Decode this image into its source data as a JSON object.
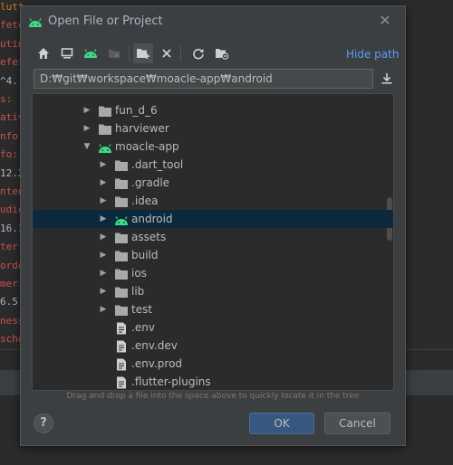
{
  "background_editor": {
    "lines": [
      {
        "text": "lutter:",
        "color": "#cc7832"
      },
      {
        "text": "fetch",
        "color": "#c75450"
      },
      {
        "text": "utin",
        "color": "#c75450"
      },
      {
        "text": "efer",
        "color": "#c75450"
      },
      {
        "text": "^4.",
        "color": "#a9b7c6"
      },
      {
        "text": "s:",
        "color": "#c75450"
      },
      {
        "text": "ativ",
        "color": "#c75450"
      },
      {
        "text": "nfo:",
        "color": "#c75450"
      },
      {
        "text": "fo:",
        "color": "#c75450"
      },
      {
        "text": "12.2",
        "color": "#a9b7c6"
      },
      {
        "text": "nten",
        "color": "#c75450"
      },
      {
        "text": "udic",
        "color": "#c75450"
      },
      {
        "text": "16.1",
        "color": "#a9b7c6"
      },
      {
        "text": "ter:",
        "color": "#c75450"
      },
      {
        "text": "order",
        "color": "#c75450"
      },
      {
        "text": "mer:",
        "color": "#c75450"
      },
      {
        "text": "6.5",
        "color": "#a9b7c6"
      },
      {
        "text": "ness",
        "color": "#c75450"
      },
      {
        "text": "sched",
        "color": "#c75450"
      }
    ]
  },
  "dialog": {
    "title": "Open File or Project",
    "close_icon": "close-icon",
    "toolbar": {
      "buttons": [
        {
          "name": "home-icon",
          "active": false
        },
        {
          "name": "desktop-icon",
          "active": false
        },
        {
          "name": "android-project-icon",
          "active": false
        },
        {
          "name": "module-icon",
          "active": false
        },
        {
          "name": "new-folder-icon",
          "active": true
        },
        {
          "name": "delete-icon",
          "active": false
        },
        {
          "name": "refresh-icon",
          "active": false
        },
        {
          "name": "show-hidden-icon",
          "active": false
        }
      ],
      "hide_path_label": "Hide path"
    },
    "path_value": "D:₩git₩workspace₩moacle-app₩android",
    "download_icon": "download-icon",
    "tree": {
      "rows": [
        {
          "label": "fun_d_6",
          "indent": 1,
          "arrow": "collapsed",
          "icon": "folder",
          "selected": false
        },
        {
          "label": "harviewer",
          "indent": 1,
          "arrow": "collapsed",
          "icon": "folder",
          "selected": false
        },
        {
          "label": "moacle-app",
          "indent": 1,
          "arrow": "expanded",
          "icon": "android",
          "selected": false
        },
        {
          "label": ".dart_tool",
          "indent": 2,
          "arrow": "collapsed",
          "icon": "folder",
          "selected": false
        },
        {
          "label": ".gradle",
          "indent": 2,
          "arrow": "collapsed",
          "icon": "folder",
          "selected": false
        },
        {
          "label": ".idea",
          "indent": 2,
          "arrow": "collapsed",
          "icon": "folder",
          "selected": false
        },
        {
          "label": "android",
          "indent": 2,
          "arrow": "collapsed",
          "icon": "android",
          "selected": true
        },
        {
          "label": "assets",
          "indent": 2,
          "arrow": "collapsed",
          "icon": "folder",
          "selected": false
        },
        {
          "label": "build",
          "indent": 2,
          "arrow": "collapsed",
          "icon": "folder",
          "selected": false
        },
        {
          "label": "ios",
          "indent": 2,
          "arrow": "collapsed",
          "icon": "folder",
          "selected": false
        },
        {
          "label": "lib",
          "indent": 2,
          "arrow": "collapsed",
          "icon": "folder",
          "selected": false
        },
        {
          "label": "test",
          "indent": 2,
          "arrow": "collapsed",
          "icon": "folder",
          "selected": false
        },
        {
          "label": ".env",
          "indent": 2,
          "arrow": "none",
          "icon": "file",
          "selected": false
        },
        {
          "label": ".env.dev",
          "indent": 2,
          "arrow": "none",
          "icon": "file",
          "selected": false
        },
        {
          "label": ".env.prod",
          "indent": 2,
          "arrow": "none",
          "icon": "file",
          "selected": false
        },
        {
          "label": ".flutter-plugins",
          "indent": 2,
          "arrow": "none",
          "icon": "file",
          "selected": false
        }
      ]
    },
    "hint": "Drag and drop a file into the space above to quickly locate it in the tree",
    "help_label": "?",
    "ok_label": "OK",
    "cancel_label": "Cancel"
  },
  "colors": {
    "android_green": "#3ddc84",
    "folder_gray": "#a9a9a9",
    "selection_bg": "#0d293e",
    "link_blue": "#589df6",
    "ok_button": "#365880"
  }
}
